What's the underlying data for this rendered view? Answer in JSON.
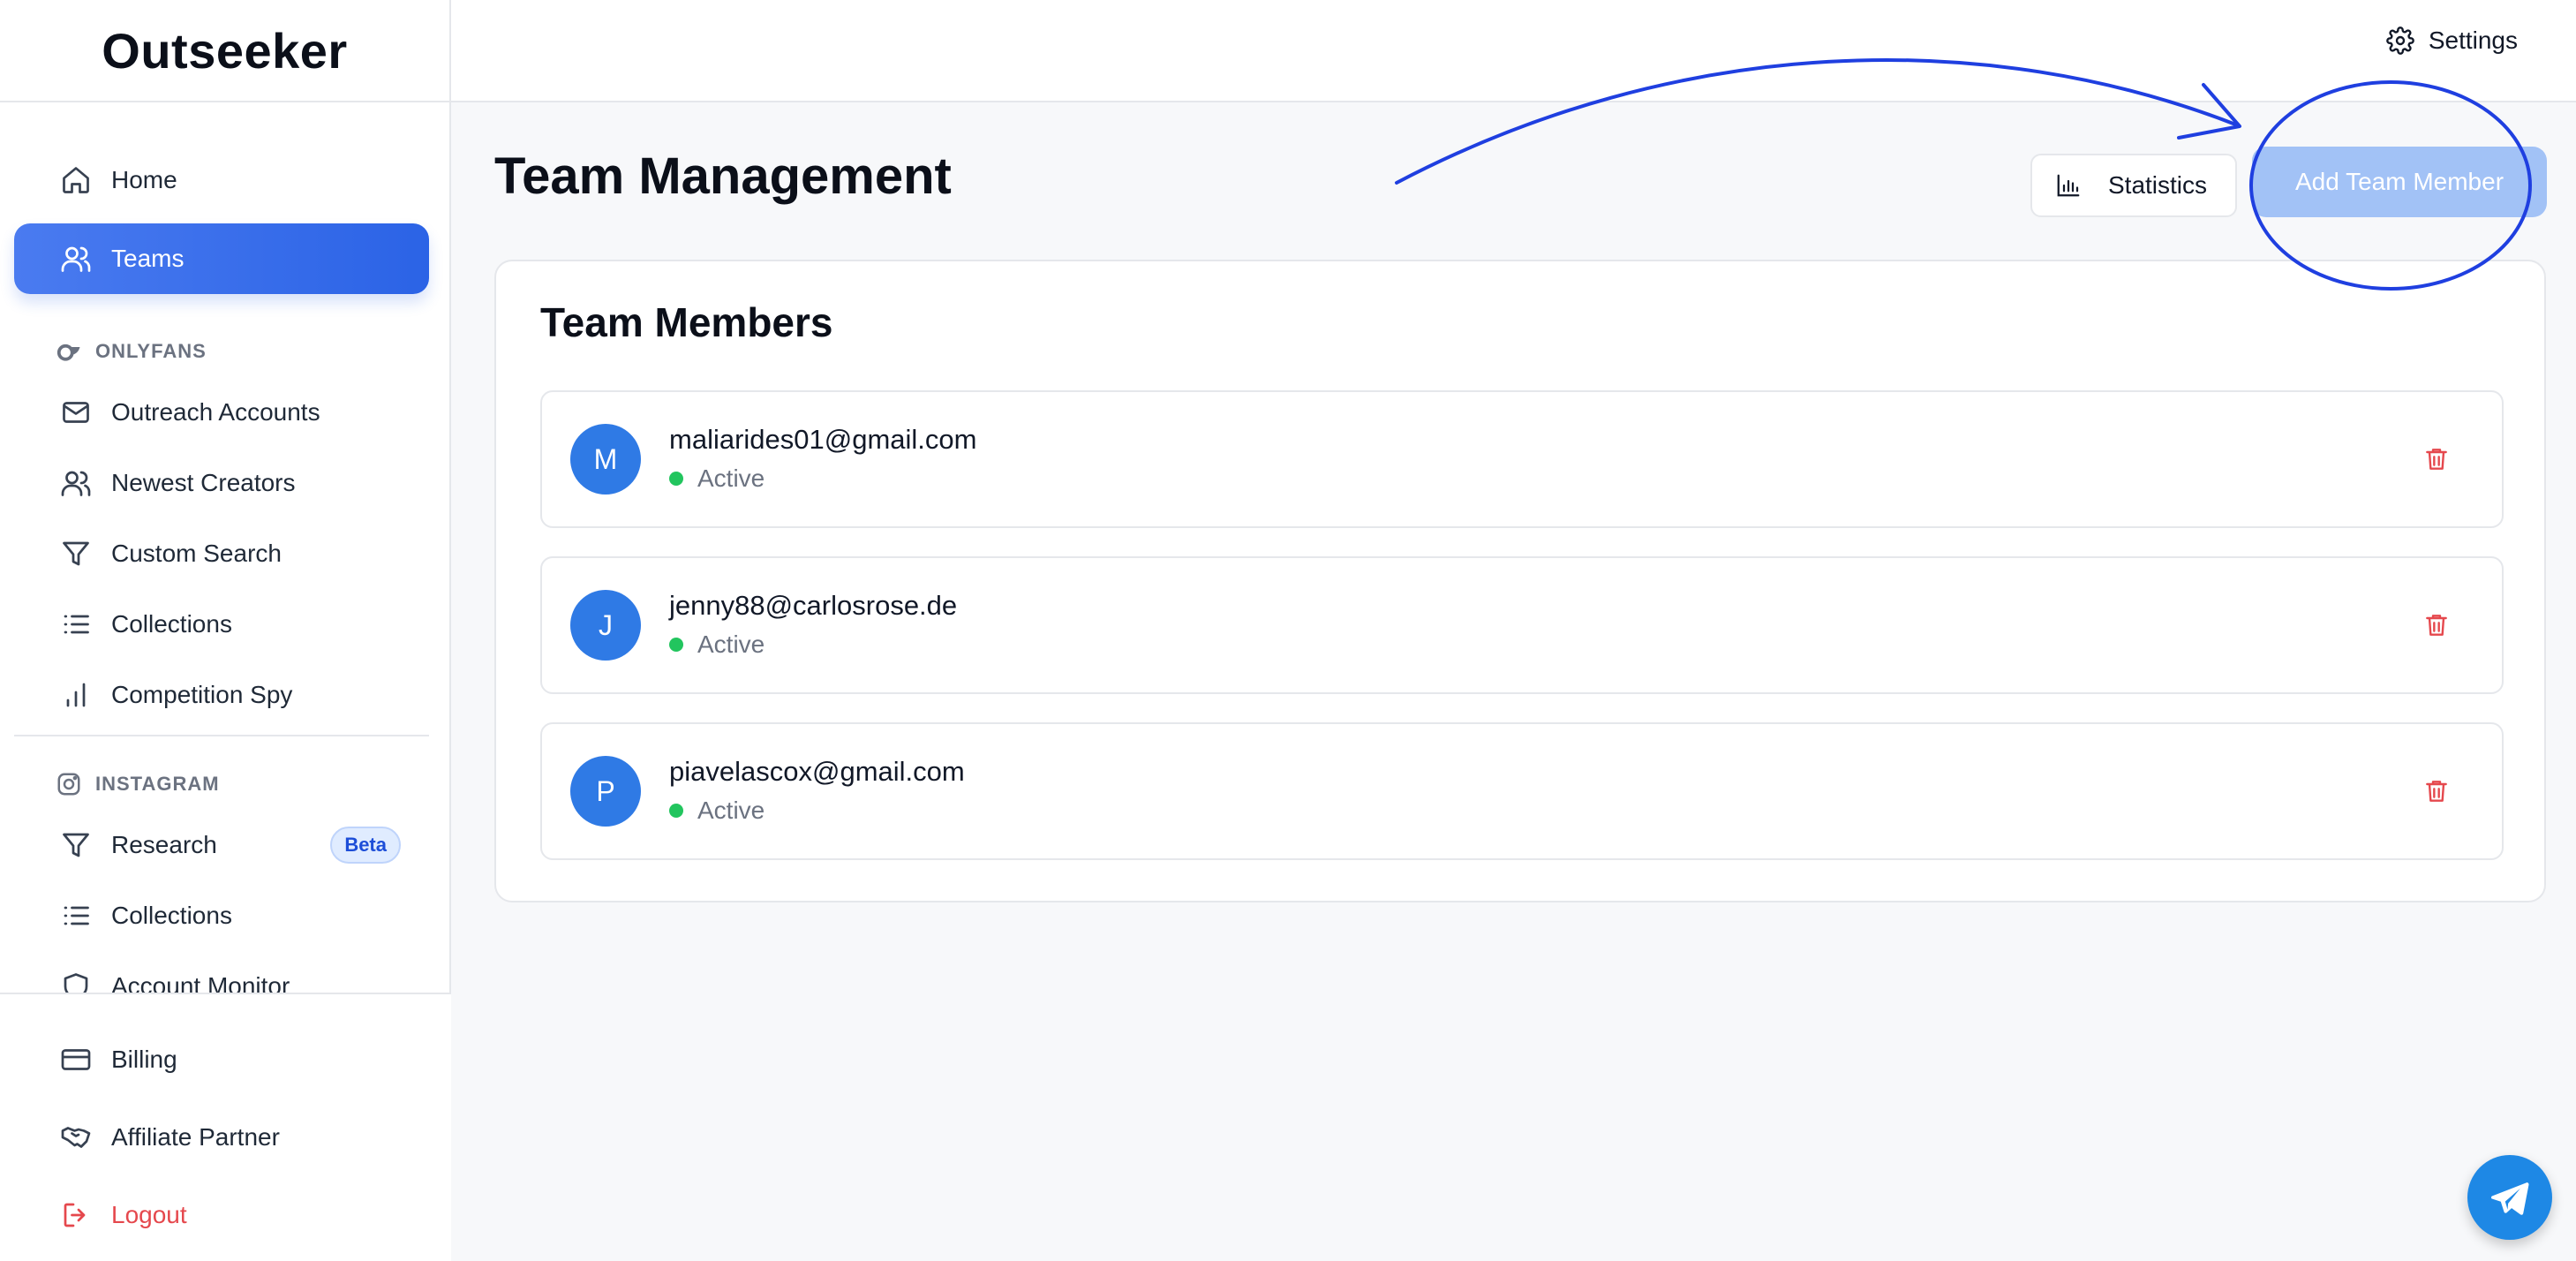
{
  "app": {
    "logo": "Outseeker"
  },
  "header": {
    "settings_label": "Settings"
  },
  "sidebar": {
    "items": [
      {
        "label": "Home",
        "icon": "home-icon"
      },
      {
        "label": "Teams",
        "icon": "users-icon",
        "active": true
      }
    ],
    "onlyfans": {
      "label": "ONLYFANS",
      "items": [
        {
          "label": "Outreach Accounts",
          "icon": "mail-icon"
        },
        {
          "label": "Newest Creators",
          "icon": "users-icon"
        },
        {
          "label": "Custom Search",
          "icon": "filter-icon"
        },
        {
          "label": "Collections",
          "icon": "list-icon"
        },
        {
          "label": "Competition Spy",
          "icon": "bar-chart-icon"
        }
      ]
    },
    "instagram": {
      "label": "INSTAGRAM",
      "items": [
        {
          "label": "Research",
          "icon": "filter-icon",
          "badge": "Beta"
        },
        {
          "label": "Collections",
          "icon": "list-icon"
        },
        {
          "label": "Account Monitor",
          "icon": "shield-icon"
        }
      ]
    },
    "bottom": [
      {
        "label": "Billing",
        "icon": "credit-card-icon"
      },
      {
        "label": "Affiliate Partner",
        "icon": "handshake-icon"
      },
      {
        "label": "Logout",
        "icon": "logout-icon"
      }
    ]
  },
  "main": {
    "title": "Team Management",
    "statistics_label": "Statistics",
    "add_member_label": "Add Team Member",
    "card_title": "Team Members",
    "members": [
      {
        "initial": "M",
        "email": "maliarides01@gmail.com",
        "status": "Active"
      },
      {
        "initial": "J",
        "email": "jenny88@carlosrose.de",
        "status": "Active"
      },
      {
        "initial": "P",
        "email": "piavelascox@gmail.com",
        "status": "Active"
      }
    ]
  },
  "colors": {
    "primary": "#2b63e6",
    "add_button": "#a2c2f6",
    "active_status": "#22c55e",
    "danger": "#e5484d",
    "annotation": "#1f3fe0"
  }
}
